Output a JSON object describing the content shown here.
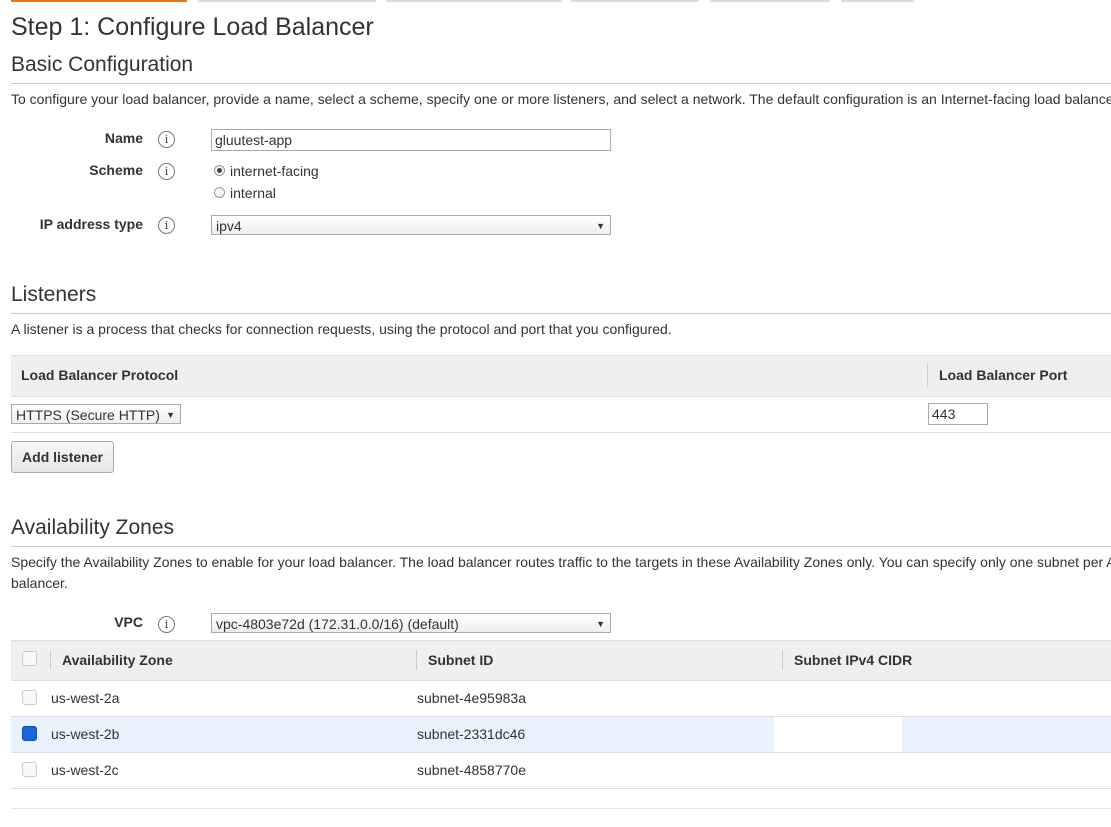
{
  "page": {
    "step_title": "Step 1: Configure Load Balancer"
  },
  "basic": {
    "title": "Basic Configuration",
    "description": "To configure your load balancer, provide a name, select a scheme, specify one or more listeners, and select a network. The default configuration is an Internet-facing load balance",
    "name_label": "Name",
    "name_value": "gluutest-app",
    "scheme_label": "Scheme",
    "scheme_options": [
      "internet-facing",
      "internal"
    ],
    "scheme_selected": "internet-facing",
    "ip_label": "IP address type",
    "ip_value": "ipv4",
    "info_glyph": "i"
  },
  "listeners": {
    "title": "Listeners",
    "description": "A listener is a process that checks for connection requests, using the protocol and port that you configured.",
    "col_protocol": "Load Balancer Protocol",
    "col_port": "Load Balancer Port",
    "protocol_value": "HTTPS (Secure HTTP)",
    "port_value": "443",
    "add_button": "Add listener"
  },
  "zones": {
    "title": "Availability Zones",
    "description_line1": "Specify the Availability Zones to enable for your load balancer. The load balancer routes traffic to the targets in these Availability Zones only. You can specify only one subnet per A",
    "description_line2": "balancer.",
    "vpc_label": "VPC",
    "vpc_value": "vpc-4803e72d (172.31.0.0/16) (default)",
    "col_zone": "Availability Zone",
    "col_subnet": "Subnet ID",
    "col_cidr": "Subnet IPv4 CIDR",
    "rows": [
      {
        "zone": "us-west-2a",
        "subnet": "subnet-4e95983a",
        "checked": false
      },
      {
        "zone": "us-west-2b",
        "subnet": "subnet-2331dc46",
        "checked": true
      },
      {
        "zone": "us-west-2c",
        "subnet": "subnet-4858770e",
        "checked": false
      }
    ]
  },
  "icons": {
    "info": "info-icon",
    "dropdown": "chevron-down-icon",
    "dropdown_glyph": "▼"
  },
  "colors": {
    "active_tab": "#e47911",
    "checkbox_checked": "#1a66d9",
    "selected_row": "#eaf2fd"
  }
}
